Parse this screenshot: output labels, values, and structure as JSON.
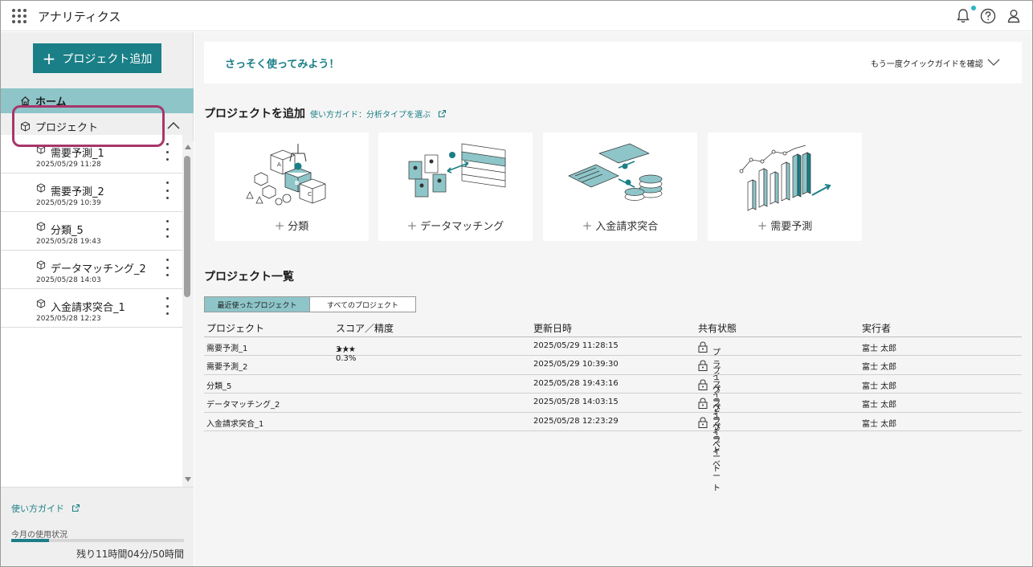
{
  "header": {
    "title": "アナリティクス"
  },
  "sidebar": {
    "add_button": "プロジェクト追加",
    "home": "ホーム",
    "projects_heading": "プロジェクト",
    "projects": [
      {
        "name": "需要予測_1",
        "date": "2025/05/29 11:28"
      },
      {
        "name": "需要予測_2",
        "date": "2025/05/29 10:39"
      },
      {
        "name": "分類_5",
        "date": "2025/05/28 19:43"
      },
      {
        "name": "データマッチング_2",
        "date": "2025/05/28 14:03"
      },
      {
        "name": "入金請求突合_1",
        "date": "2025/05/28 12:23"
      }
    ],
    "guide_link": "使い方ガイド",
    "usage_label": "今月の使用状況",
    "usage_remaining": "残り11時間04分/50時間",
    "usage_fraction": 0.22
  },
  "main": {
    "quickstart_title": "さっそく使ってみよう！",
    "quickstart_link": "もう一度クイックガイドを確認",
    "add_section_title": "プロジェクトを追加",
    "add_section_guide": "使い方ガイド：分析タイプを選ぶ",
    "cards": [
      {
        "label": "分類",
        "icon": "blocks-illustration"
      },
      {
        "label": "データマッチング",
        "icon": "documents-illustration"
      },
      {
        "label": "入金請求突合",
        "icon": "coins-illustration"
      },
      {
        "label": "需要予測",
        "icon": "bar-trend-illustration"
      }
    ],
    "list_title": "プロジェクト一覧",
    "tabs": [
      "最近使ったプロジェクト",
      "すべてのプロジェクト"
    ],
    "table": {
      "headers": [
        "プロジェクト",
        "スコア／精度",
        "更新日時",
        "共有状態",
        "実行者"
      ],
      "rows": [
        {
          "project": "需要予測_1",
          "stars": "★★★",
          "score": "3 / 0.3%",
          "updated": "2025/05/29 11:28:15",
          "share": "プライベート",
          "owner": "富士 太郎"
        },
        {
          "project": "需要予測_2",
          "stars": "",
          "score": "",
          "updated": "2025/05/29 10:39:30",
          "share": "プライベート",
          "owner": "富士 太郎"
        },
        {
          "project": "分類_5",
          "stars": "",
          "score": "",
          "updated": "2025/05/28 19:43:16",
          "share": "プライベート",
          "owner": "富士 太郎"
        },
        {
          "project": "データマッチング_2",
          "stars": "",
          "score": "",
          "updated": "2025/05/28 14:03:15",
          "share": "プライベート",
          "owner": "富士 太郎"
        },
        {
          "project": "入金請求突合_1",
          "stars": "",
          "score": "",
          "updated": "2025/05/28 12:23:29",
          "share": "プライベート",
          "owner": "富士 太郎"
        }
      ]
    }
  },
  "colors": {
    "accent": "#1a7f86",
    "selected_bg": "#8ec5c9",
    "highlight_border": "#a8356b",
    "notification_dot": "#29b6c5"
  }
}
